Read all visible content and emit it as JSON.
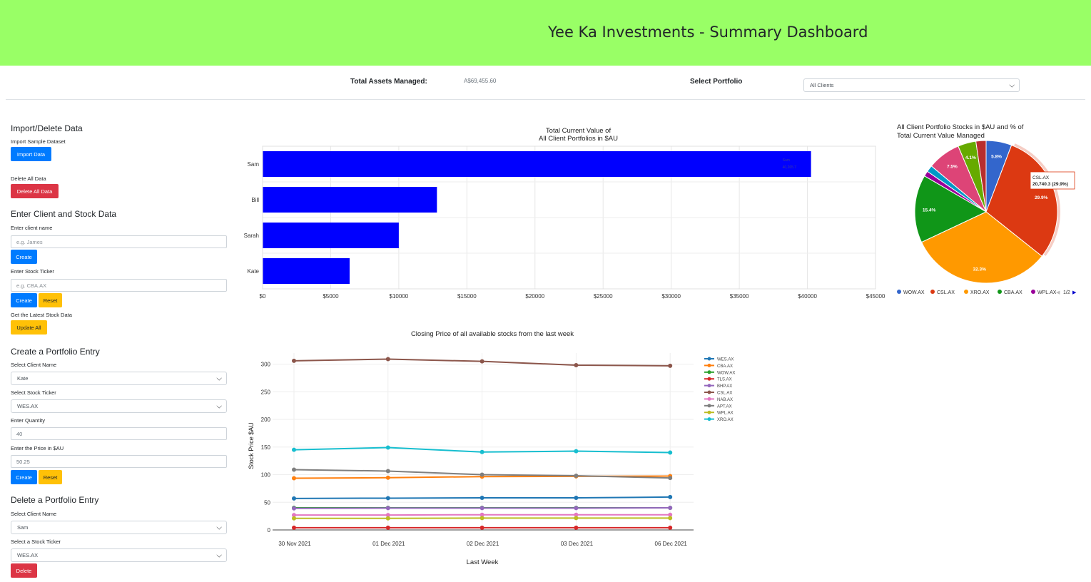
{
  "header": {
    "title": "Yee Ka Investments - Summary Dashboard"
  },
  "summary": {
    "total_label": "Total Assets Managed:",
    "total_value": "A$69,455.60",
    "select_label": "Select Portfolio",
    "select_value": "All Clients"
  },
  "import_delete": {
    "title": "Import/Delete Data",
    "import_label": "Import Sample Dataset",
    "import_button": "Import Data",
    "delete_label": "Delete All Data",
    "delete_button": "Delete All Data"
  },
  "client_stock": {
    "title": "Enter Client and Stock Data",
    "client_label": "Enter client name",
    "client_placeholder": "e.g. James",
    "client_create": "Create",
    "ticker_label": "Enter Stock Ticker",
    "ticker_placeholder": "e.g. CBA.AX",
    "ticker_create": "Create",
    "ticker_reset": "Reset",
    "latest_label": "Get the Latest Stock Data",
    "update_button": "Update All"
  },
  "create_entry": {
    "title": "Create a Portfolio Entry",
    "client_label": "Select Client Name",
    "client_value": "Kate",
    "ticker_label": "Select Stock Ticker",
    "ticker_value": "WES.AX",
    "qty_label": "Enter Quantity",
    "qty_value": "40",
    "price_label": "Enter the Price in $AU",
    "price_value": "50.25",
    "create_button": "Create",
    "reset_button": "Reset"
  },
  "delete_entry": {
    "title": "Delete a Portfolio Entry",
    "client_label": "Select Client Name",
    "client_value": "Sam",
    "ticker_label": "Select a Stock Ticker",
    "ticker_value": "WES.AX",
    "delete_button": "Delete"
  },
  "colors": {
    "header_bg": "#99ff66",
    "primary": "#007bff",
    "danger": "#dc3545",
    "warning": "#ffc107",
    "bar": "#0000ff"
  },
  "chart_data": [
    {
      "type": "bar",
      "orientation": "horizontal",
      "title": "Total Current Value of\nAll Client Portfolios in $AU",
      "categories": [
        "Sam",
        "Bill",
        "Sarah",
        "Kate"
      ],
      "values": [
        40265.7,
        12800,
        10000,
        6390
      ],
      "xlim": [
        0,
        45000
      ],
      "xticks": [
        "$0",
        "$5000",
        "$10000",
        "$15000",
        "$20000",
        "$25000",
        "$30000",
        "$35000",
        "$40000",
        "$45000"
      ],
      "tooltip": {
        "category": "Sam",
        "value": "40,265.7"
      },
      "grid": true
    },
    {
      "type": "pie",
      "title": "All Client Portfolio Stocks in $AU and % of Total Current Value Managed",
      "slices": [
        {
          "name": "WOW.AX",
          "percent": 5.8,
          "label": "5.8%",
          "color": "#3366cc"
        },
        {
          "name": "CSL.AX",
          "percent": 29.9,
          "label": "29.9%",
          "color": "#dc3912"
        },
        {
          "name": "XRO.AX",
          "percent": 32.3,
          "label": "32.3%",
          "color": "#ff9900"
        },
        {
          "name": "CBA.AX",
          "percent": 15.4,
          "label": "15.4%",
          "color": "#109618"
        },
        {
          "name": "WPL.AX",
          "percent": 1.2,
          "label": "",
          "color": "#990099"
        },
        {
          "name": "",
          "percent": 1.5,
          "label": "",
          "color": "#0099c6"
        },
        {
          "name": "",
          "percent": 7.5,
          "label": "7.5%",
          "color": "#dd4477"
        },
        {
          "name": "",
          "percent": 4.1,
          "label": "4.1%",
          "color": "#66aa00"
        },
        {
          "name": "",
          "percent": 2.3,
          "label": "",
          "color": "#b82e2e"
        }
      ],
      "tooltip": {
        "name": "CSL.AX",
        "value": "20,740.3 (29.9%)"
      },
      "legend": [
        "WOW.AX",
        "CSL.AX",
        "XRO.AX",
        "CBA.AX",
        "WPL.AX"
      ],
      "legend_page": "1/2",
      "legend_position": "bottom"
    },
    {
      "type": "line",
      "title": "Closing Price of all available stocks from the last week",
      "xlabel": "Last Week",
      "ylabel": "Stock Price $AU",
      "categories": [
        "30 Nov 2021",
        "01 Dec 2021",
        "02 Dec 2021",
        "03 Dec 2021",
        "06 Dec 2021"
      ],
      "ylim": [
        0,
        320
      ],
      "yticks": [
        "0",
        "50",
        "100",
        "150",
        "200",
        "250",
        "300"
      ],
      "series": [
        {
          "name": "WES.AX",
          "color": "#1f77b4",
          "values": [
            57,
            57.5,
            58,
            58,
            59.5
          ]
        },
        {
          "name": "CBA.AX",
          "color": "#ff7f0e",
          "values": [
            93.5,
            94.5,
            96.5,
            97,
            97.5
          ]
        },
        {
          "name": "WOW.AX",
          "color": "#2ca02c",
          "values": [
            40,
            40,
            40,
            40,
            40
          ]
        },
        {
          "name": "TLS.AX",
          "color": "#d62728",
          "values": [
            4,
            4,
            4,
            4,
            4
          ]
        },
        {
          "name": "BHP.AX",
          "color": "#9467bd",
          "values": [
            39,
            39.5,
            39.5,
            39.5,
            40
          ]
        },
        {
          "name": "CSL.AX",
          "color": "#8c564b",
          "values": [
            306,
            309,
            305,
            298,
            297
          ]
        },
        {
          "name": "NAB.AX",
          "color": "#e377c2",
          "values": [
            27,
            27,
            27.5,
            27.5,
            27.5
          ]
        },
        {
          "name": "APT.AX",
          "color": "#7f7f7f",
          "values": [
            109,
            106.5,
            100,
            98,
            94
          ]
        },
        {
          "name": "WPL.AX",
          "color": "#bcbd22",
          "values": [
            21,
            21,
            21.5,
            21.5,
            21.5
          ]
        },
        {
          "name": "XRO.AX",
          "color": "#17becf",
          "values": [
            145,
            149,
            141,
            142.5,
            140
          ]
        }
      ],
      "legend_position": "right",
      "grid": true
    }
  ]
}
